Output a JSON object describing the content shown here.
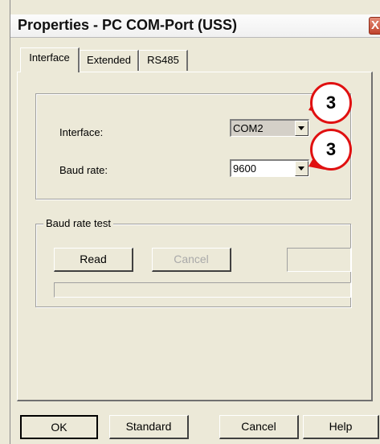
{
  "dialog": {
    "title": "Properties - PC COM-Port (USS)",
    "close_glyph": "X"
  },
  "tabs": [
    {
      "label": "Interface",
      "active": true
    },
    {
      "label": "Extended",
      "active": false
    },
    {
      "label": "RS485",
      "active": false
    }
  ],
  "interface_group": {
    "interface_label": "Interface:",
    "interface_value": "COM2",
    "baud_label": "Baud rate:",
    "baud_value": "9600"
  },
  "baud_test": {
    "title": "Baud rate test",
    "read_label": "Read",
    "cancel_label": "Cancel",
    "cancel_enabled": false,
    "result_value": "",
    "progress": 0
  },
  "callouts": [
    {
      "text": "3",
      "color": "#e01010"
    },
    {
      "text": "3",
      "color": "#e01010"
    }
  ],
  "footer": {
    "ok_label": "OK",
    "standard_label": "Standard",
    "cancel_label": "Cancel",
    "help_label": "Help"
  },
  "colors": {
    "dialog_bg": "#ece9d8",
    "callout_red": "#e01010"
  }
}
